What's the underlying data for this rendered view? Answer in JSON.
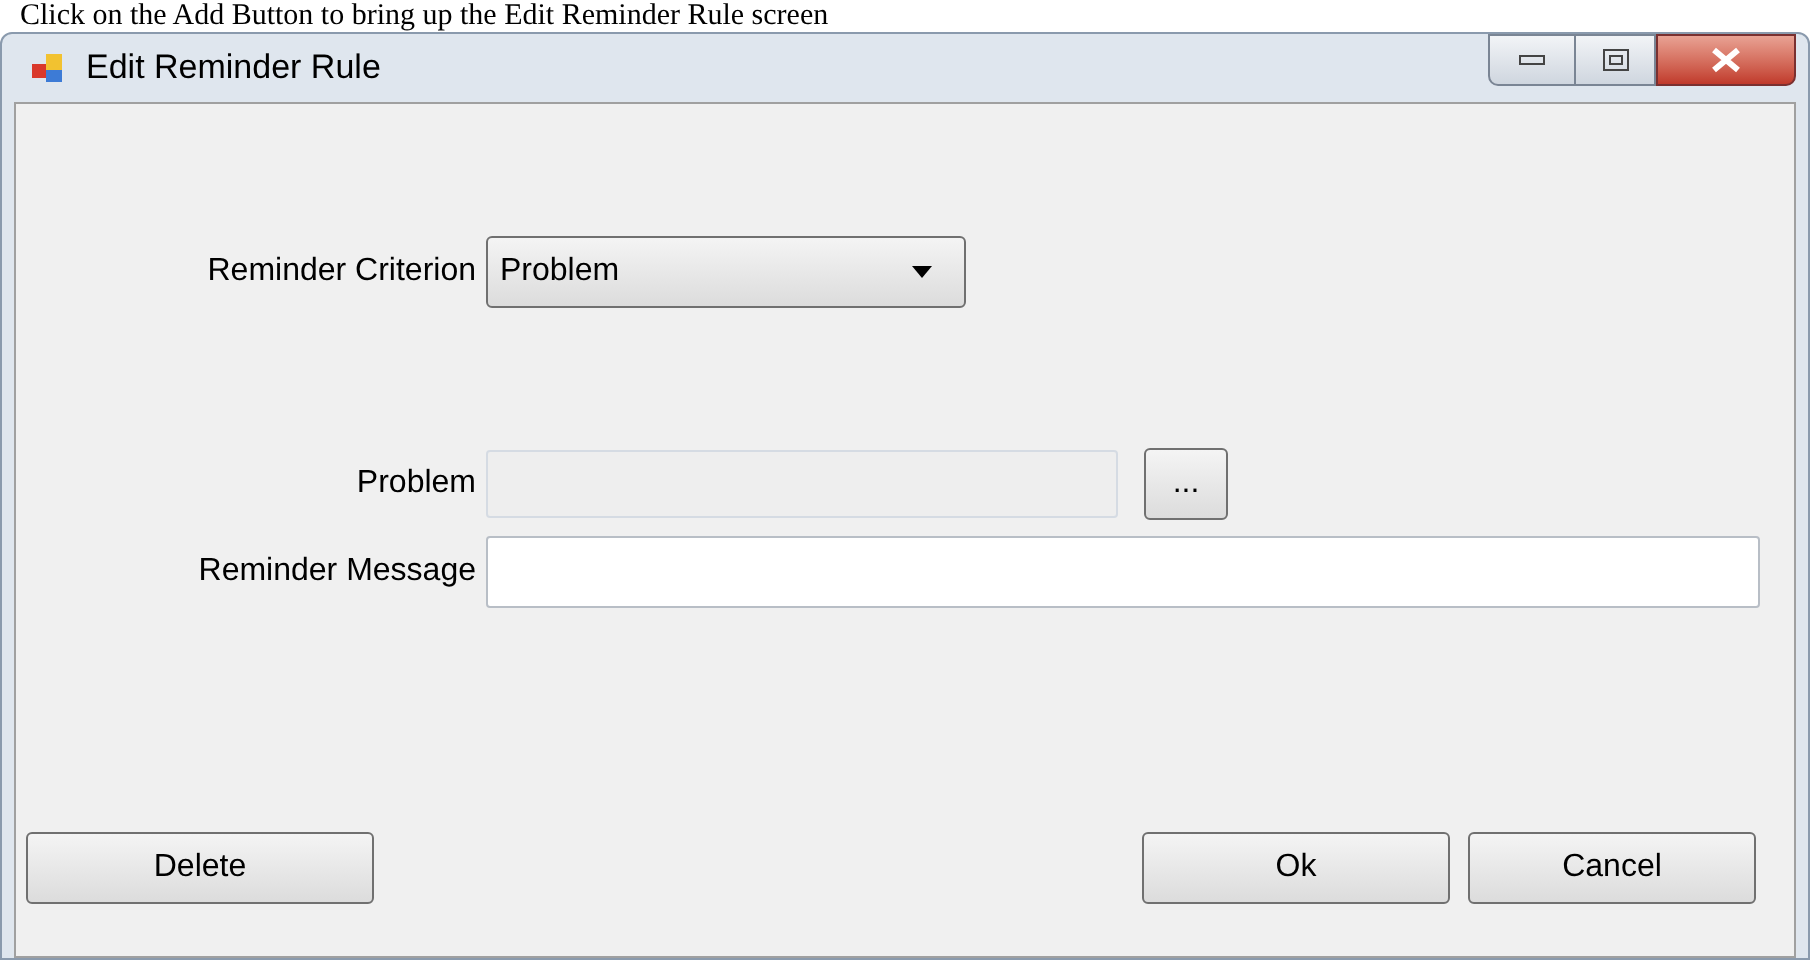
{
  "caption": "Click on the Add Button to bring up the Edit Reminder Rule screen",
  "window": {
    "title": "Edit Reminder Rule"
  },
  "criterion": {
    "label": "Reminder Criterion",
    "value": "Problem"
  },
  "problem": {
    "label": "Problem",
    "disabled": true,
    "browse": "..."
  },
  "message": {
    "label": "Reminder Message"
  },
  "buttons": {
    "delete": "Delete",
    "ok": "Ok",
    "cancel": "Cancel"
  }
}
